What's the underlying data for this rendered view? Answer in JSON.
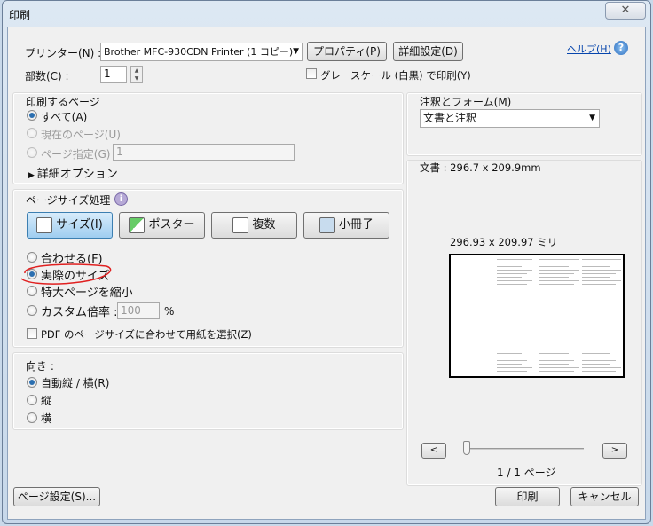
{
  "window": {
    "title": "印刷",
    "close_icon": "close-icon"
  },
  "printer": {
    "label": "プリンター(N) :",
    "value": "Brother MFC-930CDN Printer (1 コピー)",
    "properties": "プロパティ(P)",
    "advanced": "詳細設定(D)",
    "help": "ヘルプ(H)"
  },
  "copies": {
    "label": "部数(C) :",
    "value": "1"
  },
  "grayscale": {
    "label": "グレースケール (白黒) で印刷(Y)",
    "checked": false
  },
  "pages": {
    "title": "印刷するページ",
    "all": "すべて(A)",
    "current": "現在のページ(U)",
    "range": "ページ指定(G)",
    "range_value": "1",
    "more": "詳細オプション",
    "selected": "all"
  },
  "sizing": {
    "title": "ページサイズ処理",
    "tabs": [
      "サイズ(I)",
      "ポスター",
      "複数",
      "小冊子"
    ],
    "active_tab": 0,
    "options": [
      "合わせる(F)",
      "実際のサイズ",
      "特大ページを縮小",
      "カスタム倍率 :"
    ],
    "selected": 1,
    "custom_value": "100",
    "percent": "%",
    "pdf_paper": "PDF のページサイズに合わせて用紙を選択(Z)",
    "pdf_paper_checked": false,
    "highlight_color": "#e02020"
  },
  "orientation": {
    "title": "向き :",
    "options": [
      "自動縦 / 横(R)",
      "縦",
      "横"
    ],
    "selected": 0
  },
  "annotations": {
    "title": "注釈とフォーム(M)",
    "value": "文書と注釈"
  },
  "preview": {
    "doc_size": "文書 : 296.7 x 209.9mm",
    "paper_size": "296.93 x 209.97 ミリ",
    "prev": "<",
    "next": ">",
    "page": "1 / 1 ページ",
    "slider_value": 1
  },
  "footer": {
    "page_setup": "ページ設定(S)...",
    "print": "印刷",
    "cancel": "キャンセル"
  }
}
